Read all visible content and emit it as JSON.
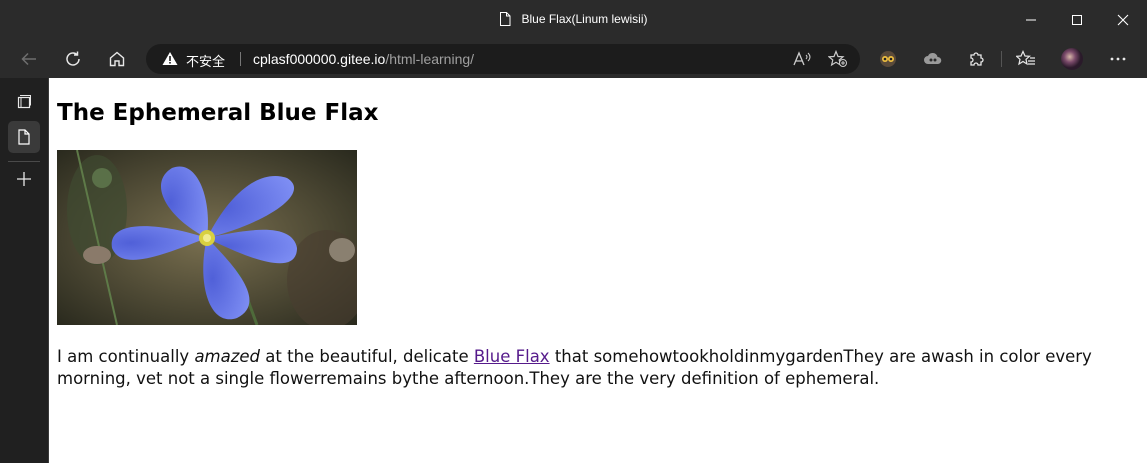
{
  "window": {
    "title": "Blue Flax(Linum lewisii)",
    "minimize_icon": "minimize-icon",
    "maximize_icon": "maximize-icon",
    "close_icon": "close-icon"
  },
  "toolbar": {
    "back_icon": "back-arrow-icon",
    "refresh_icon": "refresh-icon",
    "home_icon": "home-icon",
    "security_label": "不安全",
    "url_host": "cplasf000000.gitee.io",
    "url_path": "/html-learning/",
    "read_aloud_icon": "read-aloud-icon",
    "favorite_icon": "add-favorite-icon",
    "extension1_icon": "extension-owl-icon",
    "extension2_icon": "extension-cloud-icon",
    "extensions_icon": "puzzle-icon",
    "favorites_icon": "favorites-list-icon",
    "profile_icon": "avatar",
    "menu_icon": "more-icon"
  },
  "sidebar": {
    "tab_actions_icon": "tab-actions-icon",
    "active_tab_icon": "page-icon",
    "new_tab_icon": "plus-icon"
  },
  "page": {
    "heading": "The Ephemeral Blue Flax",
    "para_part1": "I am continually ",
    "para_em": "amazed",
    "para_part2": " at the beautiful, delicate ",
    "para_link": "Blue Flax",
    "para_part3": " that somehowtookholdinmygardenThey are awash in color every morning, vet not a single flowerremains bythe afternoon.They are the very definition of ephemeral."
  },
  "colors": {
    "chrome_bg": "#2b2b2b",
    "address_bg": "#1c1c1c",
    "link": "#551a8b",
    "flower_petal": "#6b7ff0"
  }
}
